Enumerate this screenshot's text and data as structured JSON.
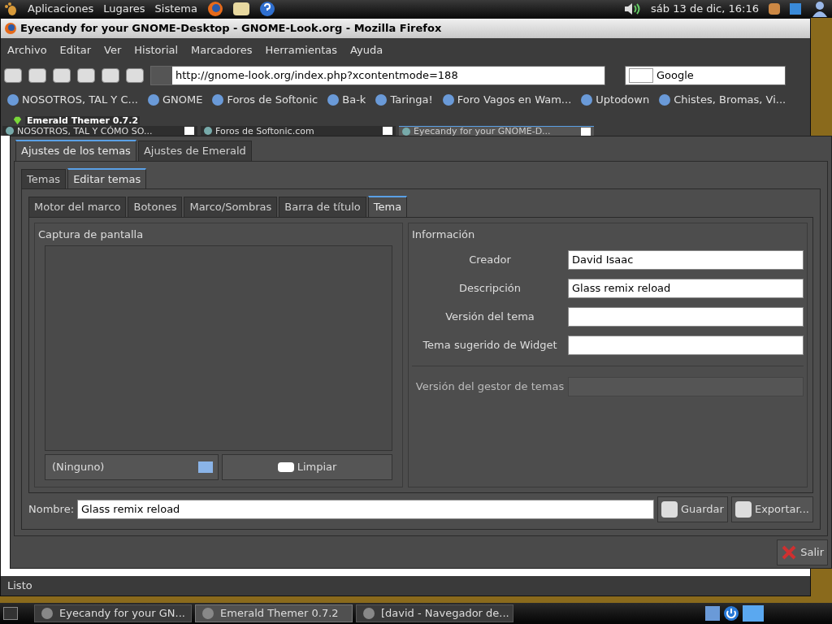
{
  "top_panel": {
    "menus": [
      "Aplicaciones",
      "Lugares",
      "Sistema"
    ],
    "clock": "sáb 13 de dic, 16:16"
  },
  "browser": {
    "title": "Eyecandy for your GNOME-Desktop - GNOME-Look.org - Mozilla Firefox",
    "menu": [
      "Archivo",
      "Editar",
      "Ver",
      "Historial",
      "Marcadores",
      "Herramientas",
      "Ayuda"
    ],
    "url": "http://gnome-look.org/index.php?xcontentmode=188",
    "search": "Google",
    "bookmarks": [
      "NOSOTROS, TAL Y C...",
      "GNOME",
      "Foros de Softonic",
      "Ba-k",
      "Taringa!",
      "Foro Vagos en Wam...",
      "Uptodown",
      "Chistes, Bromas, Vi..."
    ],
    "tabs": [
      {
        "label": "NOSOTROS, TAL Y CÓMO SO...",
        "selected": false
      },
      {
        "label": "Foros de Softonic.com",
        "selected": false
      },
      {
        "label": "Eyecandy for your GNOME-D...",
        "selected": true
      }
    ],
    "status": "Listo"
  },
  "themer": {
    "title": "Emerald Themer 0.7.2",
    "main_tabs": [
      {
        "label": "Ajustes de los temas",
        "selected": true
      },
      {
        "label": "Ajustes de Emerald",
        "selected": false
      }
    ],
    "sub_tabs": [
      {
        "label": "Temas",
        "selected": false
      },
      {
        "label": "Editar temas",
        "selected": true
      }
    ],
    "section_tabs": [
      {
        "label": "Motor del marco",
        "selected": false
      },
      {
        "label": "Botones",
        "selected": false
      },
      {
        "label": "Marco/Sombras",
        "selected": false
      },
      {
        "label": "Barra de título",
        "selected": false
      },
      {
        "label": "Tema",
        "selected": true
      }
    ],
    "screenshot": {
      "heading": "Captura de pantalla",
      "file": "(Ninguno)",
      "clear": "Limpiar"
    },
    "info": {
      "heading": "Información",
      "fields": [
        {
          "label": "Creador",
          "value": "David Isaac",
          "disabled": false
        },
        {
          "label": "Descripción",
          "value": "Glass remix reload",
          "disabled": false
        },
        {
          "label": "Versión del tema",
          "disabled": false
        },
        {
          "label": "Tema sugerido de Widget",
          "disabled": false
        },
        {
          "label": "Versión del gestor de temas",
          "disabled": true
        }
      ]
    },
    "name": {
      "label": "Nombre:",
      "value": "Glass remix reload"
    },
    "buttons": [
      "Guardar",
      "Exportar..."
    ],
    "quit": "Salir"
  },
  "taskbar": {
    "items": [
      {
        "label": "Eyecandy for your GN...",
        "selected": false
      },
      {
        "label": "Emerald Themer 0.7.2",
        "selected": true
      },
      {
        "label": "[david - Navegador de...",
        "selected": false
      }
    ]
  }
}
